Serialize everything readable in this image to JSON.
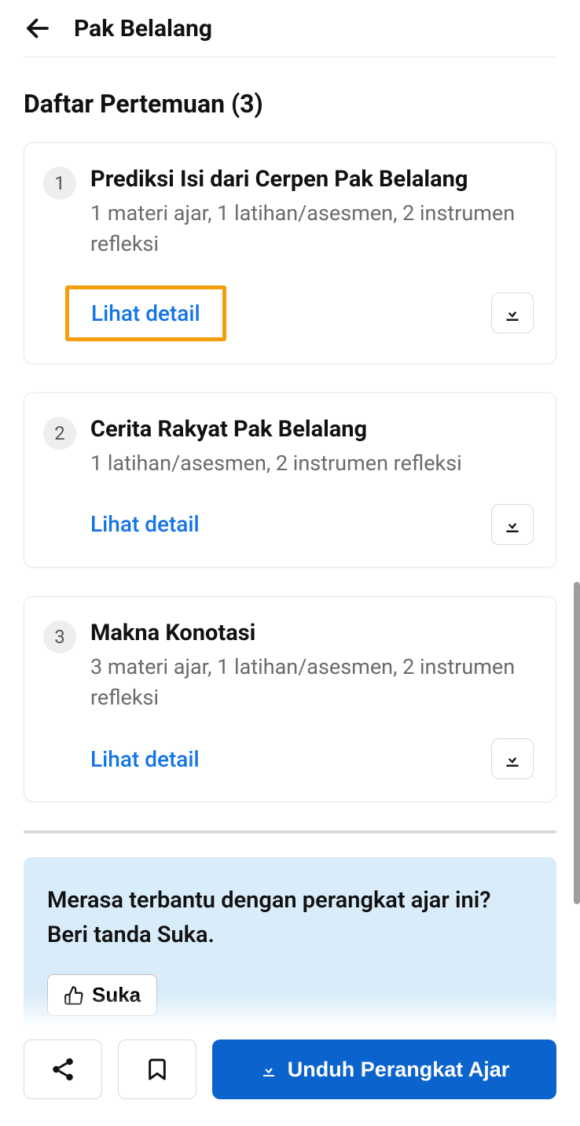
{
  "header": {
    "title": "Pak Belalang"
  },
  "section": {
    "title": "Daftar Pertemuan (3)"
  },
  "meetings": [
    {
      "num": "1",
      "title": "Prediksi Isi dari Cerpen Pak Belalang",
      "desc": "1 materi ajar, 1 latihan/asesmen, 2 instrumen refleksi",
      "detail_label": "Lihat detail",
      "highlighted": true
    },
    {
      "num": "2",
      "title": "Cerita Rakyat Pak Belalang",
      "desc": "1 latihan/asesmen, 2 instrumen refleksi",
      "detail_label": "Lihat detail",
      "highlighted": false
    },
    {
      "num": "3",
      "title": "Makna Konotasi",
      "desc": "3 materi ajar, 1 latihan/asesmen, 2 instrumen refleksi",
      "detail_label": "Lihat detail",
      "highlighted": false
    }
  ],
  "feedback": {
    "text": "Merasa terbantu dengan perangkat ajar ini? Beri tanda Suka.",
    "like_label": "Suka"
  },
  "footer": {
    "download_label": "Unduh Perangkat Ajar"
  },
  "colors": {
    "link": "#1473e6",
    "highlight": "#f59e0b",
    "primary": "#0b63ce",
    "feedback_bg": "#d9ecf9"
  }
}
